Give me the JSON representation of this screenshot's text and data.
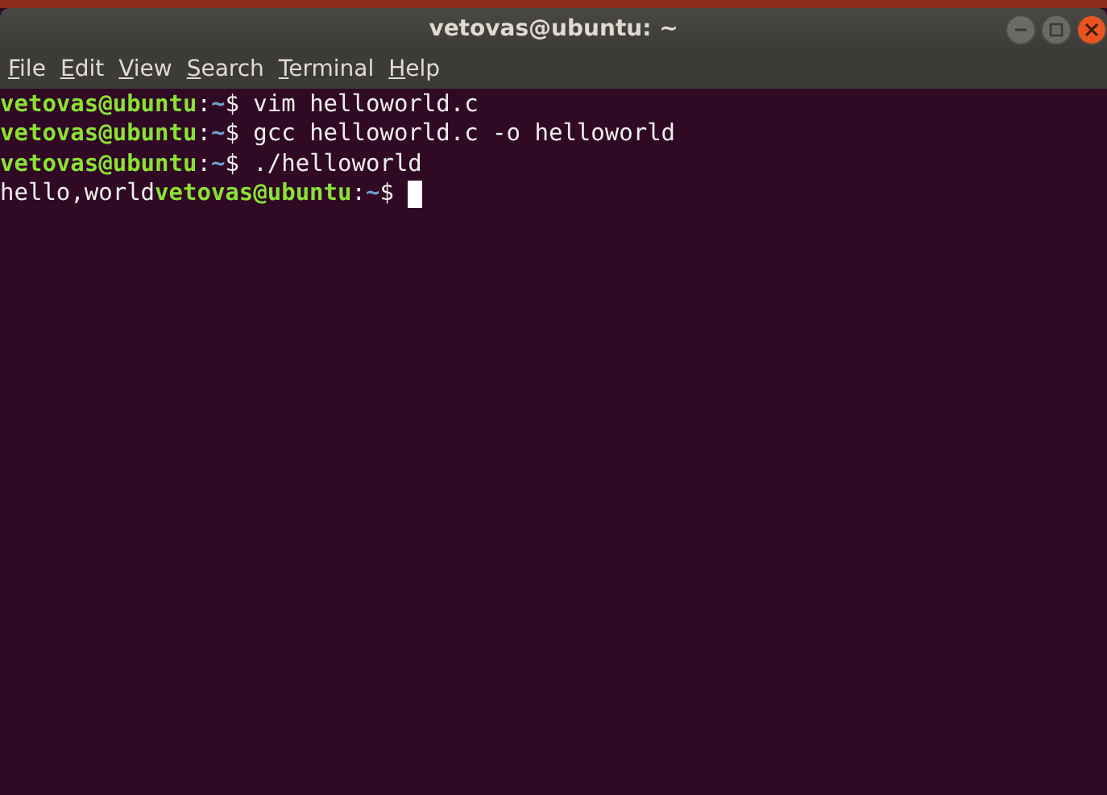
{
  "window": {
    "title": "vetovas@ubuntu: ~"
  },
  "menu": [
    {
      "label": "File",
      "underline_first": true
    },
    {
      "label": "Edit",
      "underline_first": true
    },
    {
      "label": "View",
      "underline_first": true
    },
    {
      "label": "Search",
      "underline_first": true
    },
    {
      "label": "Terminal",
      "underline_first": true
    },
    {
      "label": "Help",
      "underline_first": true
    }
  ],
  "terminal": {
    "lines": [
      {
        "segments": [
          {
            "kind": "user",
            "text": "vetovas@ubuntu"
          },
          {
            "kind": "plain",
            "text": ":"
          },
          {
            "kind": "path",
            "text": "~"
          },
          {
            "kind": "plain",
            "text": "$ vim helloworld.c"
          }
        ]
      },
      {
        "segments": [
          {
            "kind": "user",
            "text": "vetovas@ubuntu"
          },
          {
            "kind": "plain",
            "text": ":"
          },
          {
            "kind": "path",
            "text": "~"
          },
          {
            "kind": "plain",
            "text": "$ gcc helloworld.c -o helloworld"
          }
        ]
      },
      {
        "segments": [
          {
            "kind": "user",
            "text": "vetovas@ubuntu"
          },
          {
            "kind": "plain",
            "text": ":"
          },
          {
            "kind": "path",
            "text": "~"
          },
          {
            "kind": "plain",
            "text": "$ ./helloworld"
          }
        ]
      },
      {
        "segments": [
          {
            "kind": "plain",
            "text": "hello,world"
          },
          {
            "kind": "user",
            "text": "vetovas@ubuntu"
          },
          {
            "kind": "plain",
            "text": ":"
          },
          {
            "kind": "path",
            "text": "~"
          },
          {
            "kind": "plain",
            "text": "$ "
          }
        ],
        "cursor": true
      }
    ]
  }
}
